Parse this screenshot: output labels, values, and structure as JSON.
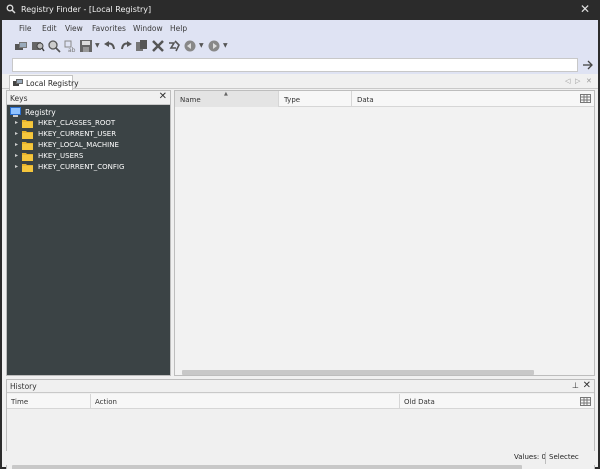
{
  "window": {
    "title": "Registry Finder - [Local Registry]",
    "close_glyph": "✕"
  },
  "menu": [
    "File",
    "Edit",
    "View",
    "Favorites",
    "Window",
    "Help"
  ],
  "toolbar_icons": [
    "connect-icon",
    "find-icon",
    "search-icon",
    "replace-icon",
    "save-icon",
    "undo-icon",
    "redo-icon",
    "copy-icon",
    "delete-icon",
    "rename-icon",
    "back-icon",
    "forward-icon"
  ],
  "address": {
    "value": "",
    "go_glyph": "→"
  },
  "tab": {
    "label": "Local Registry",
    "nav_left": "◁",
    "nav_right": "▷",
    "close": "✕"
  },
  "keys_panel": {
    "title": "Keys",
    "close_glyph": "✕",
    "root": "Registry",
    "hives": [
      "HKEY_CLASSES_ROOT",
      "HKEY_CURRENT_USER",
      "HKEY_LOCAL_MACHINE",
      "HKEY_USERS",
      "HKEY_CURRENT_CONFIG"
    ],
    "expander": "▸"
  },
  "values_panel": {
    "columns": [
      "Name",
      "Type",
      "Data"
    ],
    "sort_glyph": "▲"
  },
  "history_panel": {
    "title": "History",
    "pin_glyph": "⊥",
    "close_glyph": "✕",
    "columns": [
      "Time",
      "Action",
      "Old Data"
    ]
  },
  "status": {
    "values": "Values: 0",
    "selected": "Selectec"
  },
  "colors": {
    "titlebar": "#2b2b2b",
    "menubar": "#dfe3f3",
    "tree_bg": "#3b4345",
    "folder": "#f5c63c"
  }
}
